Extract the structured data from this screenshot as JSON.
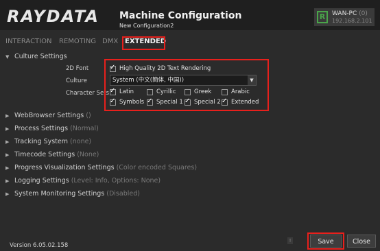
{
  "header": {
    "logo": "RAYDATA",
    "title": "Machine Configuration",
    "subtitle": "New Configuration2",
    "connection": {
      "icon_letter": "R",
      "host": "WAN-PC",
      "count": "(0)",
      "ip": "192.168.2.101"
    }
  },
  "tabs": [
    {
      "label": "INTERACTION",
      "active": false
    },
    {
      "label": "REMOTING",
      "active": false
    },
    {
      "label": "DMX",
      "active": false
    },
    {
      "label": "EXTENDED",
      "active": true
    }
  ],
  "culture": {
    "heading": "Culture Settings",
    "font_label": "2D Font",
    "font_option": {
      "label": "High Quality 2D Text Rendering",
      "checked": true
    },
    "culture_label": "Culture",
    "culture_value": "System (中文(簡体, 中国))",
    "charset_label": "Character Sets",
    "charsets": [
      {
        "label": "Latin",
        "checked": true
      },
      {
        "label": "Cyrillic",
        "checked": false
      },
      {
        "label": "Greek",
        "checked": false
      },
      {
        "label": "Arabic",
        "checked": false
      },
      {
        "label": "Symbols",
        "checked": true
      },
      {
        "label": "Special 1",
        "checked": true
      },
      {
        "label": "Special 2",
        "checked": true
      },
      {
        "label": "Extended",
        "checked": true
      }
    ]
  },
  "sections": [
    {
      "label": "WebBrowser Settings",
      "extra": "()"
    },
    {
      "label": "Process Settings",
      "extra": "(Normal)"
    },
    {
      "label": "Tracking System",
      "extra": "(none)"
    },
    {
      "label": "Timecode Settings",
      "extra": "(None)"
    },
    {
      "label": "Progress Visualization Settings",
      "extra": "(Color encoded Squares)"
    },
    {
      "label": "Logging Settings",
      "extra": "(Level: Info, Options: None)"
    },
    {
      "label": "System Monitoring Settings",
      "extra": "(Disabled)"
    }
  ],
  "footer": {
    "version": "Version 6.05.02.158",
    "info_glyph": "!",
    "save_label": "Save",
    "close_label": "Close"
  },
  "colors": {
    "highlight": "#e8201c",
    "status_green": "#4aa54a",
    "background": "#2b2b2b"
  }
}
